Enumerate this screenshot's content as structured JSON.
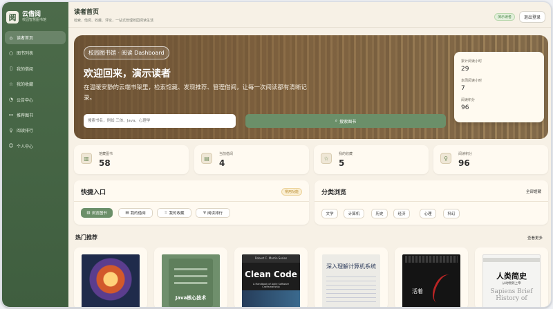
{
  "brand": {
    "logo_char": "阅",
    "name": "云借阅",
    "subtitle": "校园智慧图书馆"
  },
  "sidebar": {
    "items": [
      {
        "label": "读者首页",
        "icon": "home-icon",
        "active": true
      },
      {
        "label": "图书列表",
        "icon": "search-icon"
      },
      {
        "label": "我的借阅",
        "icon": "document-icon"
      },
      {
        "label": "我的收藏",
        "icon": "star-icon"
      },
      {
        "label": "公告中心",
        "icon": "bell-icon"
      },
      {
        "label": "推荐图书",
        "icon": "book-icon"
      },
      {
        "label": "阅读排行",
        "icon": "trophy-icon"
      },
      {
        "label": "个人中心",
        "icon": "user-icon"
      }
    ]
  },
  "header": {
    "title": "读者首页",
    "subtitle": "检索、借阅、收藏、评论，一站式管理校园阅读生活",
    "role_badge": "演示读者",
    "logout_label": "退出登录"
  },
  "hero": {
    "tag": "校园图书馆 · 阅读 Dashboard",
    "title": "欢迎回来，演示读者",
    "description": "在温暖安静的云端书架里，检索馆藏、发现推荐、管理借阅，让每一次阅读都有清晰记录。",
    "search_placeholder": "搜索书名，例如 三体、Java、心理学",
    "search_button": "搜索图书",
    "stats": [
      {
        "label": "累计阅读小时",
        "value": "29"
      },
      {
        "label": "本周阅读小时",
        "value": "7"
      },
      {
        "label": "阅读积分",
        "value": "96"
      }
    ]
  },
  "metrics": [
    {
      "label": "馆藏图书",
      "value": "58",
      "icon": "book-icon"
    },
    {
      "label": "当前借阅",
      "value": "4",
      "icon": "document-icon"
    },
    {
      "label": "我的收藏",
      "value": "5",
      "icon": "star-icon"
    },
    {
      "label": "阅读积分",
      "value": "96",
      "icon": "trophy-icon"
    }
  ],
  "quick_entry": {
    "title": "快捷入口",
    "badge": "常用功能",
    "buttons": [
      {
        "label": "浏览图书",
        "icon": "book-icon"
      },
      {
        "label": "我的借阅",
        "icon": "document-icon"
      },
      {
        "label": "我的收藏",
        "icon": "star-icon"
      },
      {
        "label": "阅读排行",
        "icon": "trophy-icon"
      }
    ]
  },
  "categories": {
    "title": "分类浏览",
    "link": "全部馆藏",
    "items": [
      "文学",
      "计算机",
      "历史",
      "经济",
      "心理",
      "科幻"
    ]
  },
  "hot": {
    "title": "热门推荐",
    "more": "查看更多",
    "books": [
      {
        "cover_text": ""
      },
      {
        "cover_text": "Java核心技术"
      },
      {
        "cover_text": "Clean Code",
        "cover_top": "Robert C. Martin Series",
        "cover_sub": "A Handbook of Agile Software Craftsmanship"
      },
      {
        "cover_text": "深入理解计算机系统"
      },
      {
        "cover_text": "活着"
      },
      {
        "cover_text": "人类简史",
        "cover_sub": "从动物到上帝",
        "cover_en": "Sapiens Brief History of"
      }
    ]
  },
  "colors": {
    "sidebar_bg": "#456645",
    "accent": "#6b8f69",
    "page_bg": "#f7f1e6",
    "card_bg": "#fffaf1"
  }
}
